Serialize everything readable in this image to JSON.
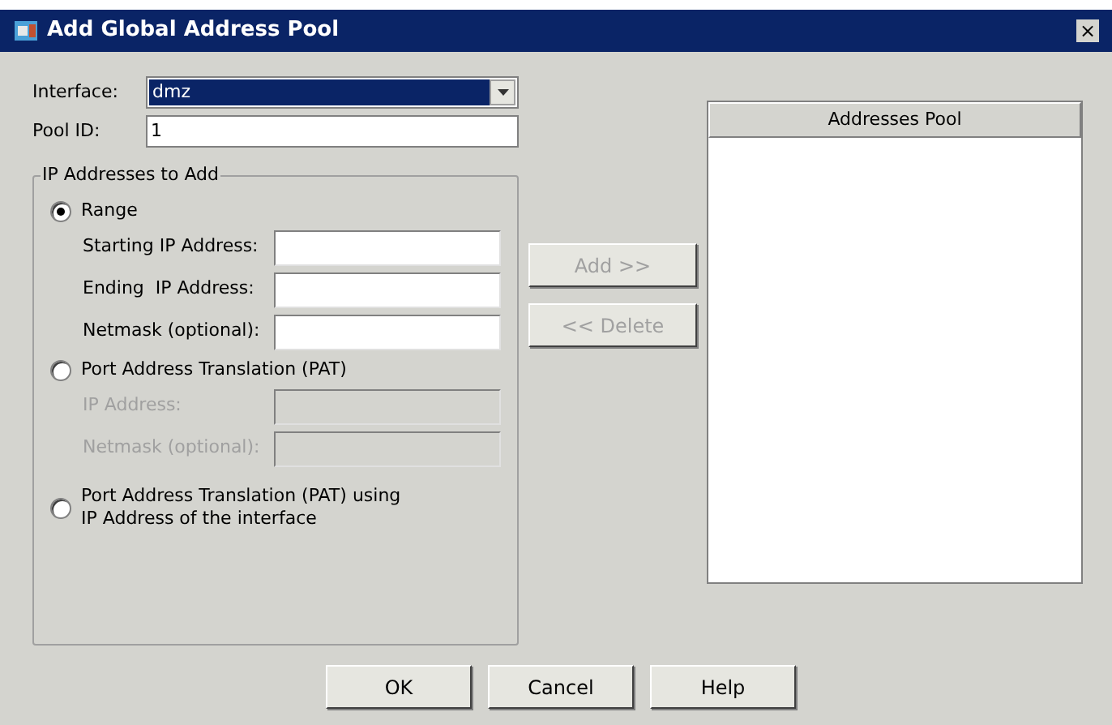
{
  "window": {
    "title": "Add Global Address Pool",
    "close": "×"
  },
  "interface": {
    "label": "Interface:",
    "value": "dmz",
    "focused": true
  },
  "pool_id": {
    "label": "Pool ID:",
    "value": "1"
  },
  "group": {
    "title": "IP Addresses to Add",
    "options": [
      {
        "label": "Range",
        "selected": true,
        "fields": [
          {
            "label": "Starting IP Address:",
            "disabled": false
          },
          {
            "label": "Ending  IP Address:",
            "disabled": false
          },
          {
            "label": "Netmask (optional):",
            "disabled": false
          }
        ]
      },
      {
        "label": "Port Address Translation (PAT)",
        "selected": false,
        "fields": [
          {
            "label": "IP Address:",
            "disabled": true
          },
          {
            "label": "Netmask (optional):",
            "disabled": true
          }
        ]
      },
      {
        "label": "Port Address Translation (PAT) using IP Address of the interface",
        "selected": false
      }
    ]
  },
  "middle_buttons": [
    {
      "label": "Add >>",
      "disabled": true
    },
    {
      "label": "<< Delete",
      "disabled": true
    }
  ],
  "pool": {
    "header": "Addresses Pool"
  },
  "buttons": [
    {
      "label": "OK"
    },
    {
      "label": "Cancel"
    },
    {
      "label": "Help"
    }
  ]
}
